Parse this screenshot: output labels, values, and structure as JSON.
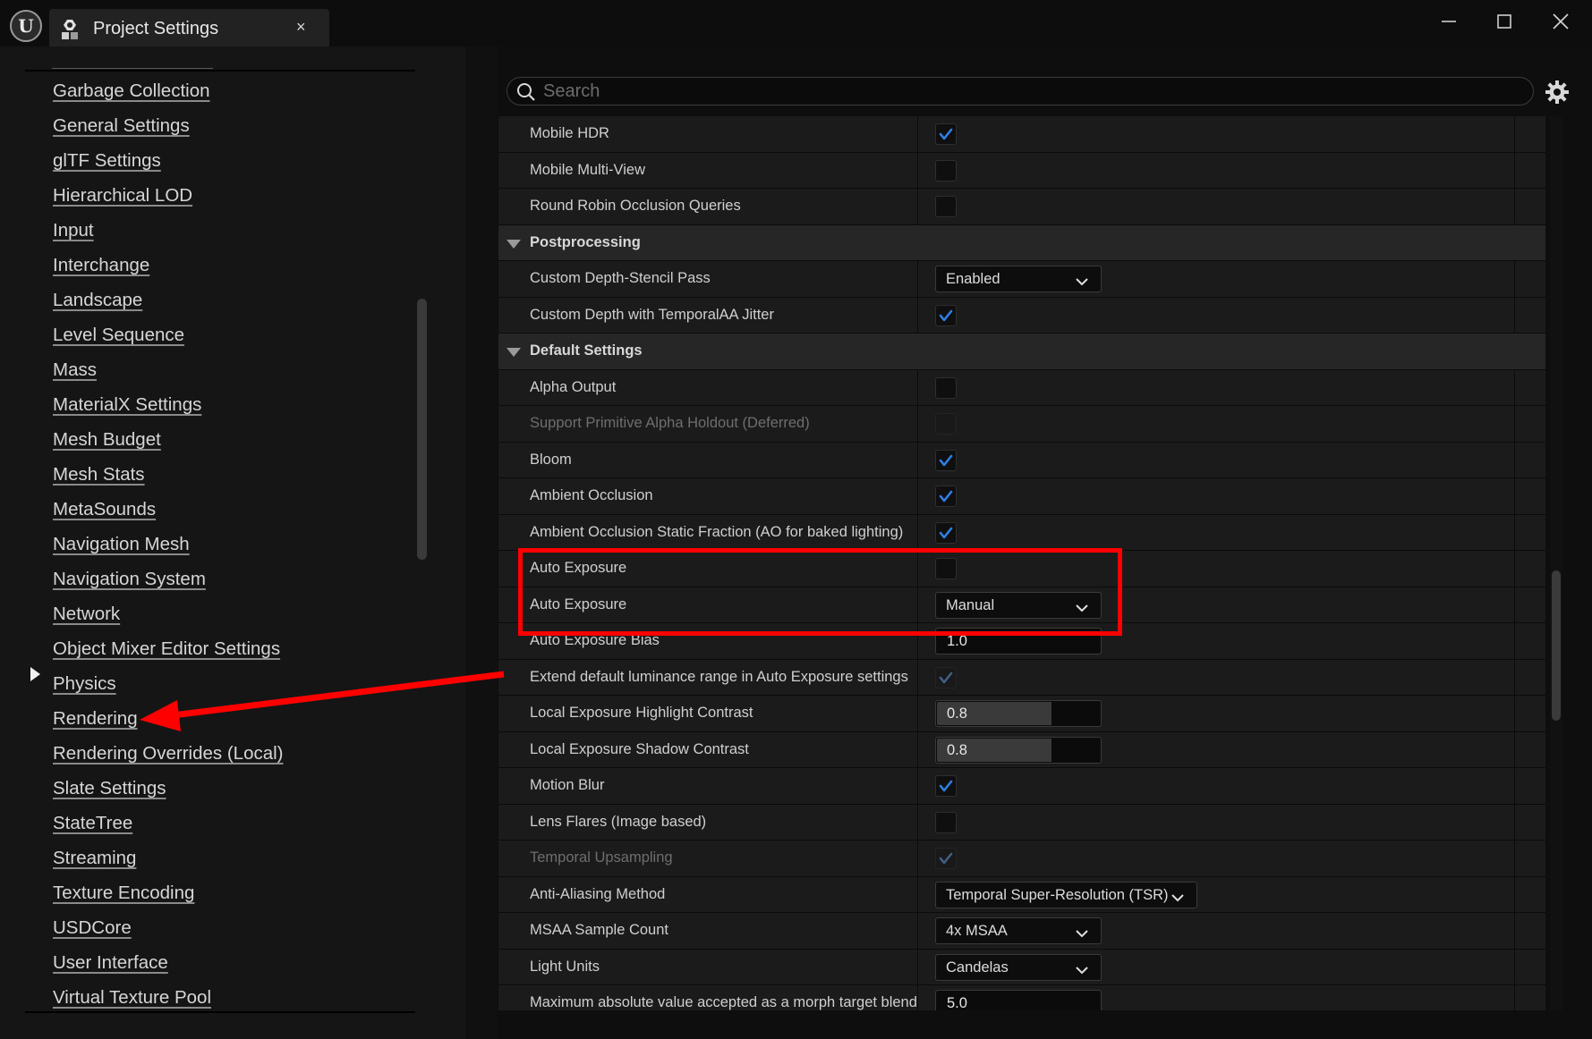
{
  "window": {
    "tab_title": "Project Settings",
    "close_tab": "×",
    "minimize": "—",
    "maximize": "☐",
    "close": "✕"
  },
  "sidebar": {
    "items": [
      {
        "label": "Garbage Collection"
      },
      {
        "label": "General Settings"
      },
      {
        "label": "glTF Settings"
      },
      {
        "label": "Hierarchical LOD"
      },
      {
        "label": "Input"
      },
      {
        "label": "Interchange"
      },
      {
        "label": "Landscape"
      },
      {
        "label": "Level Sequence"
      },
      {
        "label": "Mass"
      },
      {
        "label": "MaterialX Settings"
      },
      {
        "label": "Mesh Budget"
      },
      {
        "label": "Mesh Stats"
      },
      {
        "label": "MetaSounds"
      },
      {
        "label": "Navigation Mesh"
      },
      {
        "label": "Navigation System"
      },
      {
        "label": "Network"
      },
      {
        "label": "Object Mixer Editor Settings"
      },
      {
        "label": "Physics"
      },
      {
        "label": "Rendering",
        "selected": true
      },
      {
        "label": "Rendering Overrides (Local)"
      },
      {
        "label": "Slate Settings"
      },
      {
        "label": "StateTree"
      },
      {
        "label": "Streaming"
      },
      {
        "label": "Texture Encoding"
      },
      {
        "label": "USDCore"
      },
      {
        "label": "User Interface"
      },
      {
        "label": "Virtual Texture Pool"
      }
    ]
  },
  "search": {
    "placeholder": "Search",
    "value": ""
  },
  "colors": {
    "accent_check": "#2f7fe6",
    "annotation_red": "#ff0000",
    "panel_bg": "#151515"
  },
  "settings": {
    "rows": [
      {
        "type": "row",
        "label": "Mobile HDR",
        "control": "checkbox",
        "checked": true
      },
      {
        "type": "row",
        "label": "Mobile Multi-View",
        "control": "checkbox",
        "checked": false
      },
      {
        "type": "row",
        "label": "Round Robin Occlusion Queries",
        "control": "checkbox",
        "checked": false
      },
      {
        "type": "section",
        "label": "Postprocessing"
      },
      {
        "type": "row",
        "label": "Custom Depth-Stencil Pass",
        "control": "dropdown",
        "value": "Enabled"
      },
      {
        "type": "row",
        "label": "Custom Depth with TemporalAA Jitter",
        "control": "checkbox",
        "checked": true
      },
      {
        "type": "section",
        "label": "Default Settings"
      },
      {
        "type": "row",
        "label": "Alpha Output",
        "control": "checkbox",
        "checked": false
      },
      {
        "type": "row",
        "label": "Support Primitive Alpha Holdout (Deferred)",
        "control": "checkbox",
        "checked": false,
        "disabled": true
      },
      {
        "type": "row",
        "label": "Bloom",
        "control": "checkbox",
        "checked": true
      },
      {
        "type": "row",
        "label": "Ambient Occlusion",
        "control": "checkbox",
        "checked": true
      },
      {
        "type": "row",
        "label": "Ambient Occlusion Static Fraction (AO for baked lighting)",
        "control": "checkbox",
        "checked": true
      },
      {
        "type": "row",
        "label": "Auto Exposure",
        "control": "checkbox",
        "checked": false
      },
      {
        "type": "row",
        "label": "Auto Exposure",
        "control": "dropdown",
        "value": "Manual"
      },
      {
        "type": "row",
        "label": "Auto Exposure Bias",
        "control": "number",
        "value": "1.0"
      },
      {
        "type": "row",
        "label": "Extend default luminance range in Auto Exposure settings",
        "control": "checkbox",
        "checked": true,
        "disabled": true
      },
      {
        "type": "row",
        "label": "Local Exposure Highlight Contrast",
        "control": "slider",
        "value": "0.8",
        "fill": 0.8
      },
      {
        "type": "row",
        "label": "Local Exposure Shadow Contrast",
        "control": "slider",
        "value": "0.8",
        "fill": 0.8
      },
      {
        "type": "row",
        "label": "Motion Blur",
        "control": "checkbox",
        "checked": true
      },
      {
        "type": "row",
        "label": "Lens Flares (Image based)",
        "control": "checkbox",
        "checked": false
      },
      {
        "type": "row",
        "label": "Temporal Upsampling",
        "control": "checkbox",
        "checked": true,
        "disabled": true,
        "dim_label": true
      },
      {
        "type": "row",
        "label": "Anti-Aliasing Method",
        "control": "dropdown",
        "value": "Temporal Super-Resolution (TSR)",
        "wide": true
      },
      {
        "type": "row",
        "label": "MSAA Sample Count",
        "control": "dropdown",
        "value": "4x MSAA"
      },
      {
        "type": "row",
        "label": "Light Units",
        "control": "dropdown",
        "value": "Candelas"
      },
      {
        "type": "row",
        "label": "Maximum absolute value accepted as a morph target blend",
        "control": "number",
        "value": "5.0"
      }
    ]
  }
}
